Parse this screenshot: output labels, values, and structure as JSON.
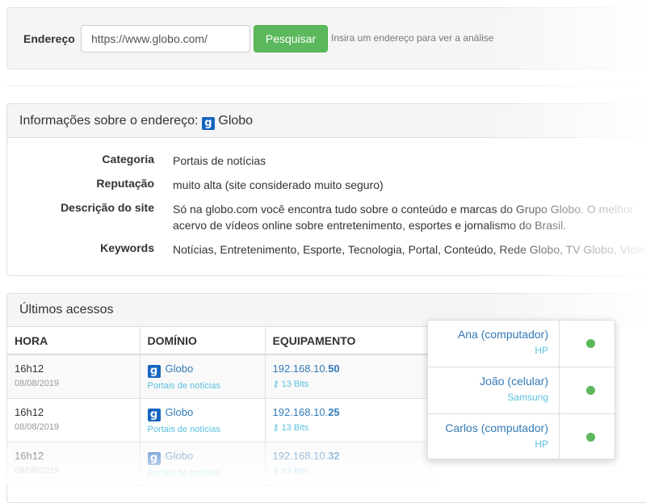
{
  "search": {
    "label": "Endereço",
    "value": "https://www.globo.com/",
    "button": "Pesquisar",
    "hint": "Insira um endereço para ver a análise"
  },
  "info": {
    "title": "Informações sobre o endereço:",
    "site_logo": "g",
    "site_name": "Globo",
    "rows": [
      {
        "key": "Categoria",
        "value": "Portais de notícias"
      },
      {
        "key": "Reputação",
        "value": "muito alta (site considerado muito seguro)"
      },
      {
        "key": "Descrição do site",
        "value": "Só na globo.com você encontra tudo sobre o conteúdo e marcas do Grupo Globo. O melhor acervo de vídeos online sobre entretenimento, esportes e jornalismo do Brasil."
      },
      {
        "key": "Keywords",
        "value": "Notícias, Entretenimento, Esporte, Tecnologia, Portal, Conteúdo, Rede Globo, TV Globo, Vídeos"
      }
    ]
  },
  "accesses": {
    "title": "Últimos acessos",
    "columns": [
      "HORA",
      "DOMÍNIO",
      "EQUIPAMENTO"
    ],
    "rows": [
      {
        "time": "16h12",
        "date": "08/08/2019",
        "domain": "Globo",
        "category": "Portais de notícias",
        "ip_prefix": "192.168.10.",
        "ip_suffix": "50",
        "bits": "13 Bits"
      },
      {
        "time": "16h12",
        "date": "08/08/2019",
        "domain": "Globo",
        "category": "Portais de notícias",
        "ip_prefix": "192.168.10.",
        "ip_suffix": "25",
        "bits": "13 Bits"
      },
      {
        "time": "16h12",
        "date": "08/08/2019",
        "domain": "Globo",
        "category": "Portais de notícias",
        "ip_prefix": "192.168.10.",
        "ip_suffix": "32",
        "bits": "13 Bits"
      }
    ]
  },
  "devices": [
    {
      "name": "Ana (computador)",
      "brand": "HP",
      "status": "online"
    },
    {
      "name": "João (celular)",
      "brand": "Samsung",
      "status": "online"
    },
    {
      "name": "Carlos (computador)",
      "brand": "HP",
      "status": "online"
    }
  ],
  "colors": {
    "accent": "#337ab7",
    "info": "#5bc0de",
    "success": "#5cb85c",
    "logo": "#1565c0"
  },
  "icons": {
    "site": "globo-g-logo",
    "bits": "sitemap-icon",
    "status": "green-dot-icon"
  }
}
